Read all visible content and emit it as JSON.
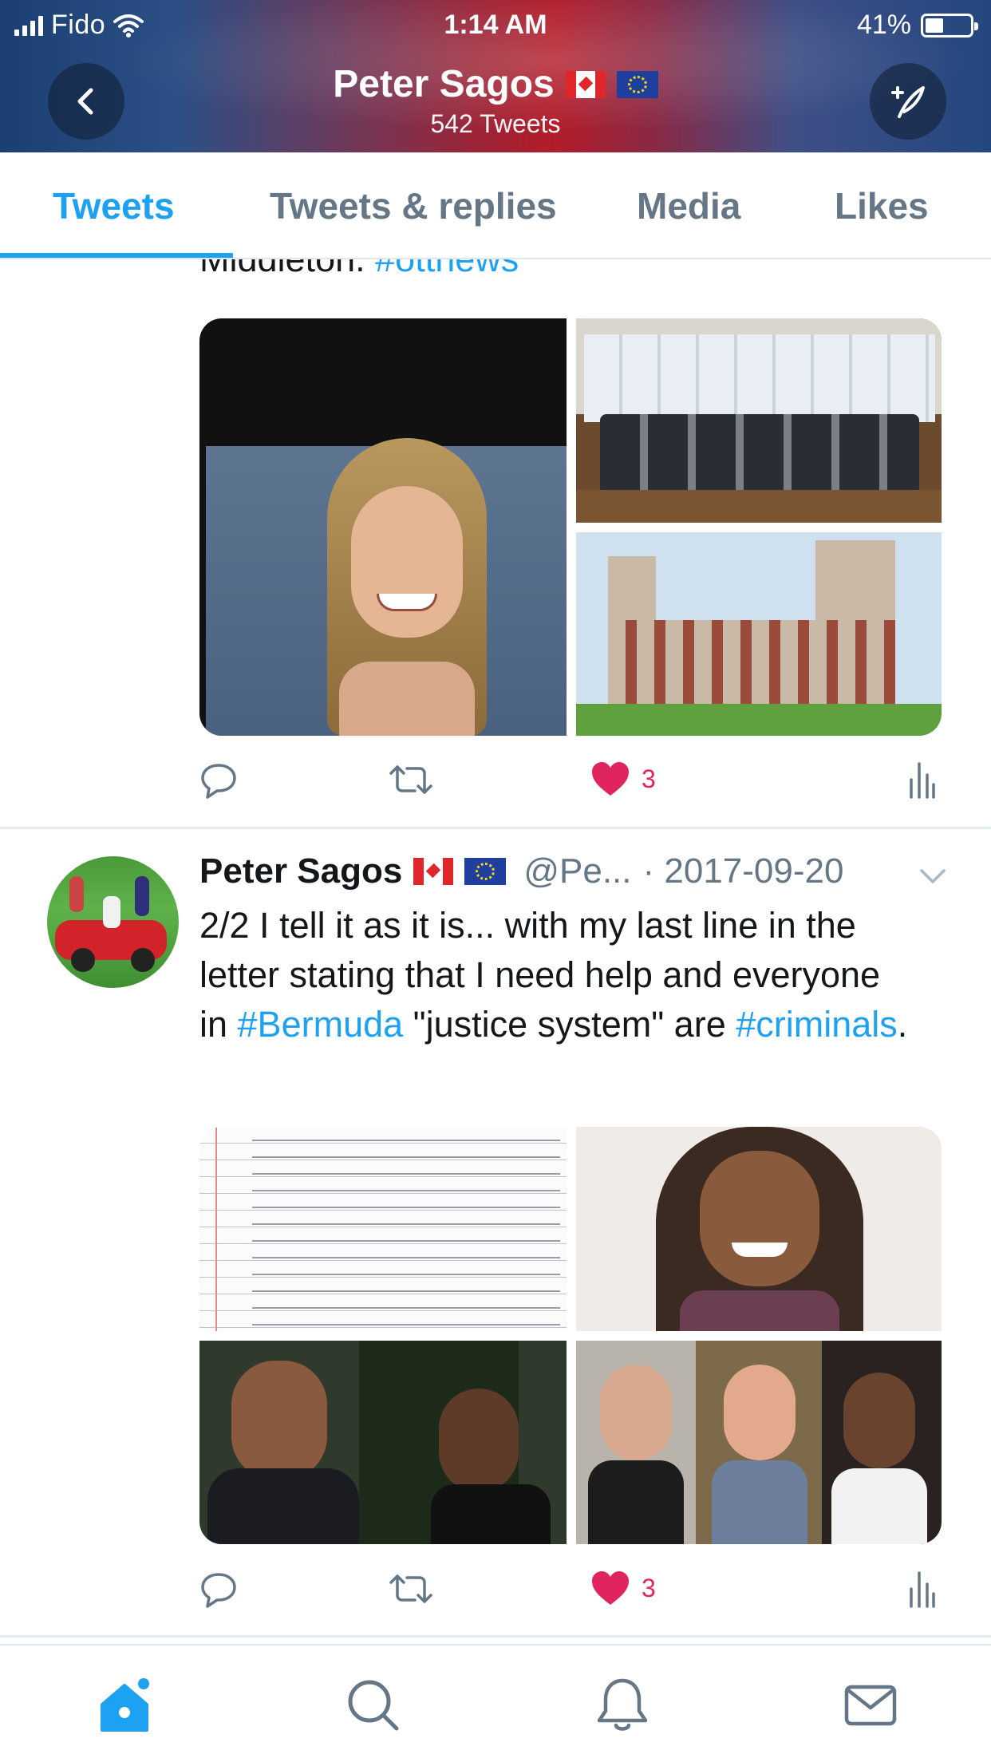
{
  "status_bar": {
    "carrier": "Fido",
    "time": "1:14 AM",
    "battery": "41%",
    "battery_level": 0.41
  },
  "header": {
    "name": "Peter Sagos",
    "tweet_count": "542 Tweets"
  },
  "tabs": [
    {
      "label": "Tweets",
      "active": true
    },
    {
      "label": "Tweets & replies",
      "active": false
    },
    {
      "label": "Media",
      "active": false
    },
    {
      "label": "Likes",
      "active": false
    }
  ],
  "tweet1": {
    "cut_text": "Middleton.",
    "cut_hashtag": "#ottnews",
    "likes": "3"
  },
  "tweet2": {
    "name": "Peter Sagos",
    "handle": "@Pe...",
    "date": "· 2017-09-20",
    "text_a": "2/2 I tell it as it is... with my last line in the letter stating that I need help and everyone in ",
    "hashtag1": "#Bermuda",
    "text_b": " \"justice system\" are ",
    "hashtag2": "#criminals",
    "text_c": ".",
    "likes": "3"
  },
  "colors": {
    "accent": "#1da1f2",
    "like": "#e0245e",
    "muted": "#657786"
  },
  "icons": [
    "back-arrow-icon",
    "compose-tweet-icon",
    "reply-icon",
    "retweet-icon",
    "heart-icon",
    "analytics-icon",
    "chevron-down-icon",
    "home-icon",
    "search-icon",
    "notifications-icon",
    "messages-icon"
  ]
}
